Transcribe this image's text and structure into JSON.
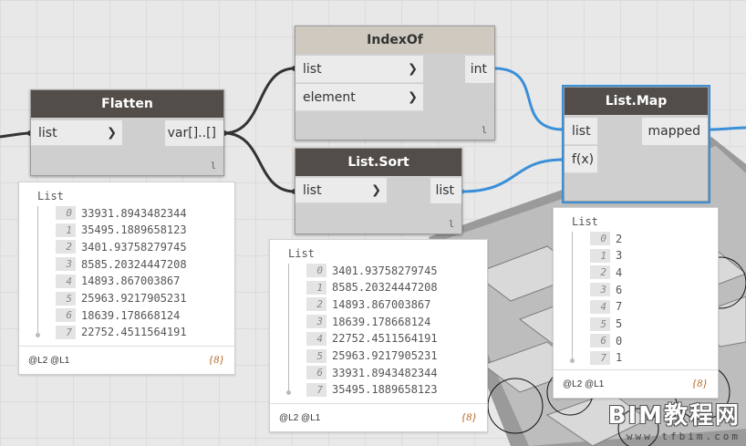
{
  "nodes": {
    "flatten": {
      "title": "Flatten",
      "in": [
        "list"
      ],
      "out": "var[]..[]",
      "lace": "l"
    },
    "indexof": {
      "title": "IndexOf",
      "in": [
        "list",
        "element"
      ],
      "out": "int",
      "lace": "l"
    },
    "sort": {
      "title": "List.Sort",
      "in": [
        "list"
      ],
      "out": "list",
      "lace": "l"
    },
    "map": {
      "title": "List.Map",
      "in": [
        "list",
        "f(x)"
      ],
      "out": "mapped"
    }
  },
  "previews": {
    "flatten": {
      "title": "List",
      "items": [
        [
          "0",
          "33931.8943482344"
        ],
        [
          "1",
          "35495.1889658123"
        ],
        [
          "2",
          "3401.93758279745"
        ],
        [
          "3",
          "8585.20324447208"
        ],
        [
          "4",
          "14893.867003867"
        ],
        [
          "5",
          "25963.9217905231"
        ],
        [
          "6",
          "18639.178668124"
        ],
        [
          "7",
          "22752.4511564191"
        ]
      ],
      "levels": "@L2 @L1",
      "count": "{8}"
    },
    "sort": {
      "title": "List",
      "items": [
        [
          "0",
          "3401.93758279745"
        ],
        [
          "1",
          "8585.20324447208"
        ],
        [
          "2",
          "14893.867003867"
        ],
        [
          "3",
          "18639.178668124"
        ],
        [
          "4",
          "22752.4511564191"
        ],
        [
          "5",
          "25963.9217905231"
        ],
        [
          "6",
          "33931.8943482344"
        ],
        [
          "7",
          "35495.1889658123"
        ]
      ],
      "levels": "@L2 @L1",
      "count": "{8}"
    },
    "map": {
      "title": "List",
      "items": [
        [
          "0",
          "2"
        ],
        [
          "1",
          "3"
        ],
        [
          "2",
          "4"
        ],
        [
          "3",
          "6"
        ],
        [
          "4",
          "7"
        ],
        [
          "5",
          "5"
        ],
        [
          "6",
          "0"
        ],
        [
          "7",
          "1"
        ]
      ],
      "levels": "@L2 @L1",
      "count": "{8}"
    }
  },
  "watermark": {
    "big": "BIM教程网",
    "small": "www.tfbim.com"
  },
  "colors": {
    "wire_active": "#3b8fd8",
    "wire_default": "#333333",
    "node_header": "#524d49",
    "selected": "#3b8fd8"
  }
}
